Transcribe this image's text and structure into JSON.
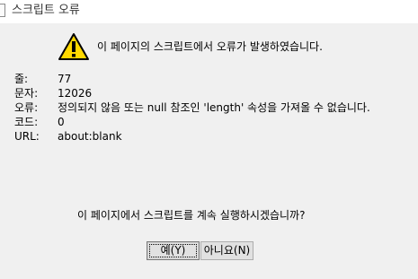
{
  "window": {
    "title": "스크립트 오류"
  },
  "message": "이 페이지의 스크립트에서 오류가 발생하였습니다.",
  "details": [
    {
      "label": "줄:",
      "value": "77"
    },
    {
      "label": "문자:",
      "value": "12026"
    },
    {
      "label": "오류:",
      "value": "정의되지 않음 또는 null 참조인 'length' 속성을 가져올 수 없습니다."
    },
    {
      "label": "코드:",
      "value": "0"
    },
    {
      "label": "URL:",
      "value": "about:blank"
    }
  ],
  "question": "이 페이지에서 스크립트를 계속 실행하시겠습니까?",
  "buttons": {
    "yes": "예(Y)",
    "no": "아니요(N)"
  },
  "icons": {
    "title_icon": "page-icon",
    "warning": "warning-icon"
  },
  "colors": {
    "warning_fill": "#ffd800",
    "warning_stroke": "#000000"
  }
}
